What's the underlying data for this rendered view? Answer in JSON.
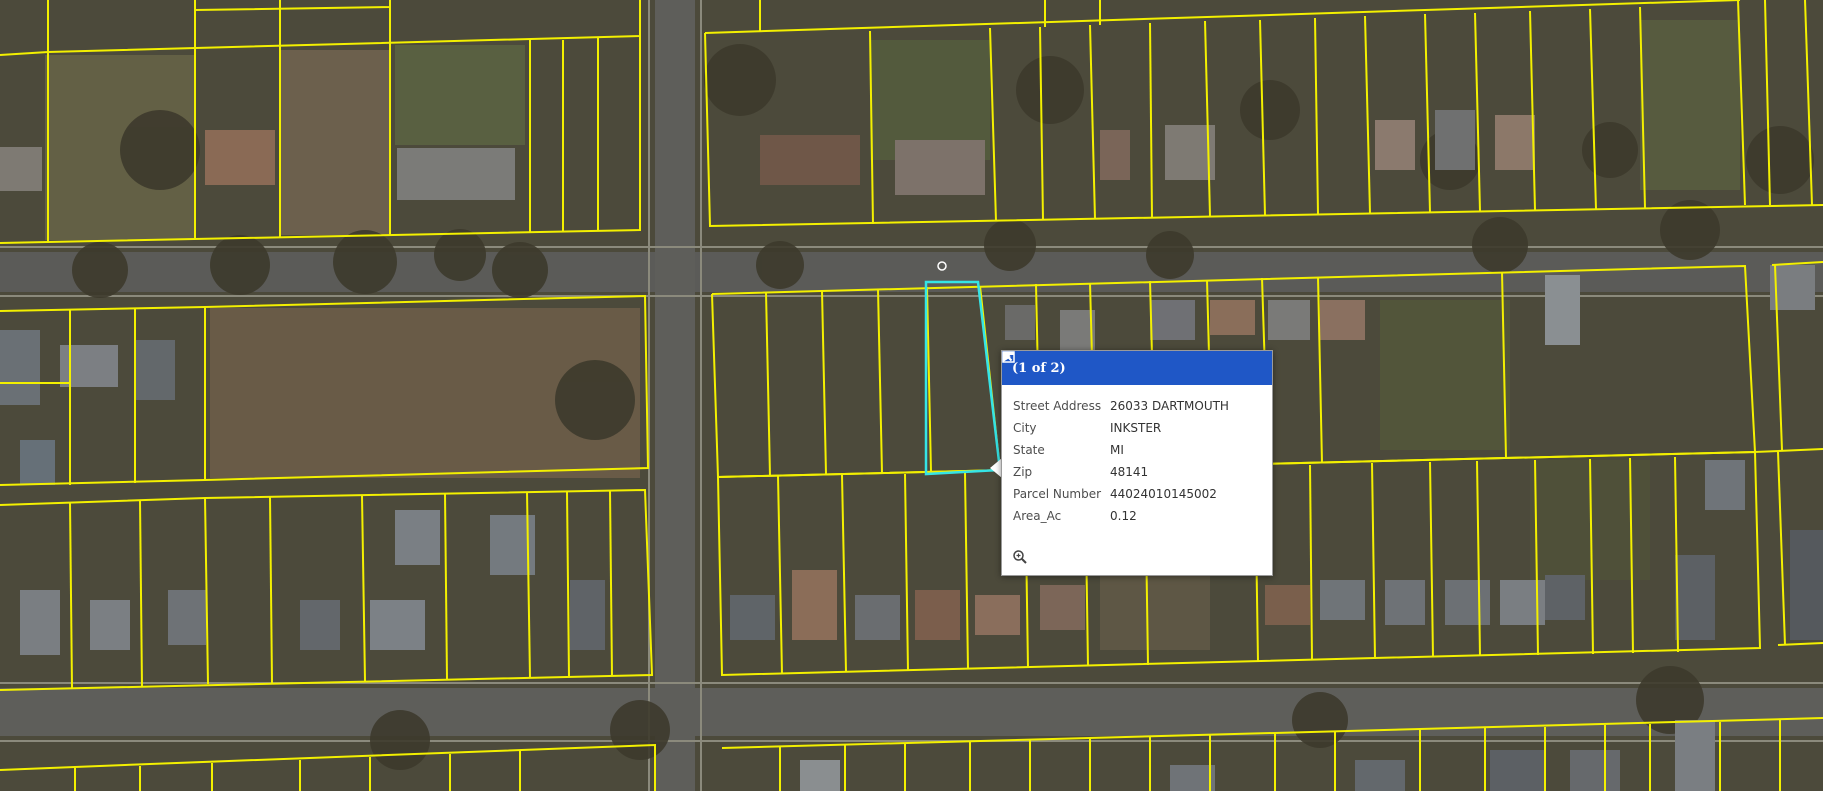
{
  "popup": {
    "title": "(1 of 2)",
    "next_icon": "play-right-icon",
    "maximize_icon": "maximize-icon",
    "close_icon": "close-icon",
    "zoom_icon": "zoom-to-icon",
    "attributes": [
      {
        "key": "Street Address",
        "value": "26033 DARTMOUTH"
      },
      {
        "key": "City",
        "value": "INKSTER"
      },
      {
        "key": "State",
        "value": "MI"
      },
      {
        "key": "Zip",
        "value": "48141"
      },
      {
        "key": "Parcel Number",
        "value": "44024010145002"
      },
      {
        "key": "Area_Ac",
        "value": "0.12"
      }
    ]
  },
  "colors": {
    "parcel_outline": "#f3f000",
    "selected_parcel": "#35e4e6",
    "road": "#595959",
    "popup_header": "#1f57c6",
    "ground": "#4a4738"
  }
}
